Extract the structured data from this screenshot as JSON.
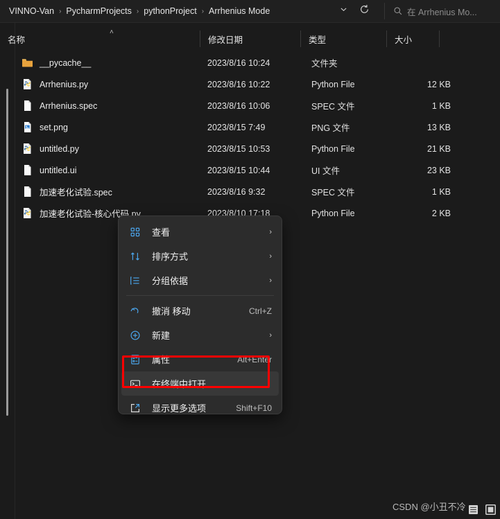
{
  "window": {
    "breadcrumb": [
      {
        "label": "VINNO-Van"
      },
      {
        "label": "PycharmProjects"
      },
      {
        "label": "pythonProject"
      },
      {
        "label": "Arrhenius Mode"
      }
    ],
    "breadcrumb_separator": "›",
    "dropdown_icon": "chevron-down-icon",
    "refresh_icon": "refresh-icon",
    "search": {
      "icon": "search-icon",
      "placeholder": "在 Arrhenius Mo..."
    }
  },
  "columns": [
    {
      "key": "name",
      "label": "名称",
      "sorted": true,
      "sort_caret": "˄"
    },
    {
      "key": "date",
      "label": "修改日期"
    },
    {
      "key": "type",
      "label": "类型"
    },
    {
      "key": "size",
      "label": "大小"
    }
  ],
  "files": [
    {
      "name": "__pycache__",
      "date": "2023/8/16 10:24",
      "type": "文件夹",
      "size": "",
      "icon": "folder-icon"
    },
    {
      "name": "Arrhenius.py",
      "date": "2023/8/16 10:22",
      "type": "Python File",
      "size": "12 KB",
      "icon": "python-file-icon"
    },
    {
      "name": "Arrhenius.spec",
      "date": "2023/8/16 10:06",
      "type": "SPEC 文件",
      "size": "1 KB",
      "icon": "blank-file-icon"
    },
    {
      "name": "set.png",
      "date": "2023/8/15 7:49",
      "type": "PNG 文件",
      "size": "13 KB",
      "icon": "image-file-icon"
    },
    {
      "name": "untitled.py",
      "date": "2023/8/15 10:53",
      "type": "Python File",
      "size": "21 KB",
      "icon": "python-file-icon"
    },
    {
      "name": "untitled.ui",
      "date": "2023/8/15 10:44",
      "type": "UI 文件",
      "size": "23 KB",
      "icon": "blank-file-icon"
    },
    {
      "name": "加速老化试验.spec",
      "date": "2023/8/16 9:32",
      "type": "SPEC 文件",
      "size": "1 KB",
      "icon": "blank-file-icon"
    },
    {
      "name": "加速老化试验-核心代码.py",
      "date": "2023/8/10 17:18",
      "type": "Python File",
      "size": "2 KB",
      "icon": "python-file-icon"
    }
  ],
  "context_menu": {
    "items": [
      {
        "label": "查看",
        "icon": "view-grid-icon",
        "accel": "",
        "submenu": true,
        "highlighted": false
      },
      {
        "label": "排序方式",
        "icon": "sort-arrows-icon",
        "accel": "",
        "submenu": true,
        "highlighted": false
      },
      {
        "label": "分组依据",
        "icon": "group-by-icon",
        "accel": "",
        "submenu": true,
        "highlighted": false
      },
      {
        "separator": true
      },
      {
        "label": "撤消 移动",
        "icon": "undo-icon",
        "accel": "Ctrl+Z",
        "submenu": false,
        "highlighted": false
      },
      {
        "label": "新建",
        "icon": "plus-circle-icon",
        "accel": "",
        "submenu": true,
        "highlighted": false
      },
      {
        "label": "属性",
        "icon": "properties-icon",
        "accel": "Alt+Enter",
        "submenu": false,
        "highlighted": false
      },
      {
        "label": "在终端中打开",
        "icon": "terminal-icon",
        "accel": "",
        "submenu": false,
        "highlighted": true
      },
      {
        "label": "显示更多选项",
        "icon": "show-more-icon",
        "accel": "Shift+F10",
        "submenu": false,
        "highlighted": false
      }
    ],
    "chevron": "›"
  },
  "annotation": {
    "type": "red-rectangle",
    "color": "#fe0000",
    "targets": "在终端中打开"
  },
  "watermark": {
    "text": "CSDN @小丑不冷"
  },
  "view_modes": [
    {
      "name": "details-view-icon",
      "active": false
    },
    {
      "name": "large-icons-view-icon",
      "active": false
    }
  ],
  "colors": {
    "background": "#1b1b1b",
    "titlebar": "#202020",
    "menu": "#2c2c2c",
    "menu_icon_accent": "#4aa3e8",
    "folder": "#e8b437",
    "annotation_red": "#fe0000"
  }
}
